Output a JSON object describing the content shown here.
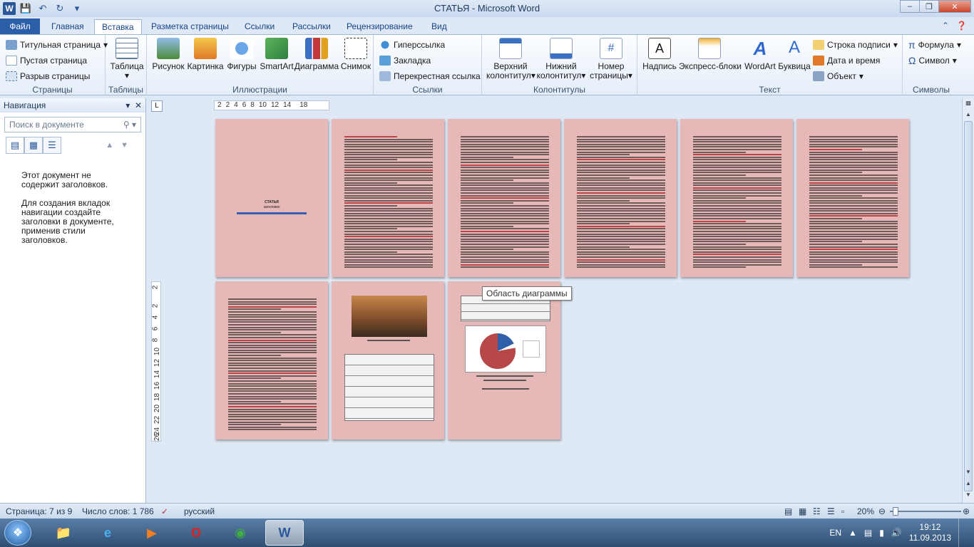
{
  "window": {
    "title": "СТАТЬЯ  -  Microsoft Word"
  },
  "tabs": [
    {
      "label": "Файл"
    },
    {
      "label": "Главная"
    },
    {
      "label": "Вставка"
    },
    {
      "label": "Разметка страницы"
    },
    {
      "label": "Ссылки"
    },
    {
      "label": "Рассылки"
    },
    {
      "label": "Рецензирование"
    },
    {
      "label": "Вид"
    }
  ],
  "ribbon": {
    "pages": {
      "label": "Страницы",
      "title_page": "Титульная страница",
      "blank_page": "Пустая страница",
      "page_break": "Разрыв страницы"
    },
    "tables": {
      "label": "Таблицы",
      "table": "Таблица"
    },
    "illustrations": {
      "label": "Иллюстрации",
      "picture": "Рисунок",
      "clipart": "Картинка",
      "shapes": "Фигуры",
      "smartart": "SmartArt",
      "chart": "Диаграмма",
      "screenshot": "Снимок"
    },
    "links": {
      "label": "Ссылки",
      "hyperlink": "Гиперссылка",
      "bookmark": "Закладка",
      "crossref": "Перекрестная ссылка"
    },
    "headers": {
      "label": "Колонтитулы",
      "header_1": "Верхний",
      "header_2": "колонтитул",
      "footer_1": "Нижний",
      "footer_2": "колонтитул",
      "pagenum_1": "Номер",
      "pagenum_2": "страницы"
    },
    "text": {
      "label": "Текст",
      "textbox": "Надпись",
      "quickparts": "Экспресс-блоки",
      "wordart": "WordArt",
      "dropcap": "Буквица",
      "signature": "Строка подписи",
      "datetime": "Дата и время",
      "object": "Объект"
    },
    "symbols": {
      "label": "Символы",
      "equation": "Формула",
      "symbol": "Символ"
    }
  },
  "nav": {
    "title": "Навигация",
    "search_placeholder": "Поиск в документе",
    "msg1": "Этот документ не содержит заголовков.",
    "msg2": "Для создания вкладок навигации создайте заголовки в документе, применив стили заголовков."
  },
  "ruler": {
    "ticks": [
      "2",
      "2",
      "4",
      "6",
      "8",
      "10",
      "12",
      "14",
      "18"
    ],
    "vticks": [
      "2",
      "2",
      "4",
      "6",
      "8",
      "10",
      "12",
      "14",
      "16",
      "18",
      "20",
      "22",
      "24",
      "26"
    ]
  },
  "tooltip": "Область диаграммы",
  "status": {
    "page": "Страница: 7 из 9",
    "words": "Число слов: 1 786",
    "lang": "русский",
    "zoom": "20%"
  },
  "taskbar": {
    "lang": "EN",
    "time": "19:12",
    "date": "11.09.2013"
  },
  "doc": {
    "page1_title": "СТАТЬЯ",
    "page1_sub": "заголовок"
  }
}
